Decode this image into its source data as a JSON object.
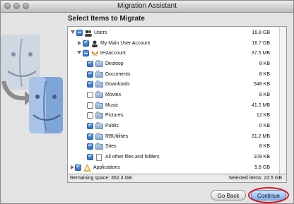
{
  "window": {
    "title": "Migration Assistant"
  },
  "heading": "Select Items to Migrate",
  "items": [
    {
      "label": "Users",
      "size": "16.8 GB",
      "state": "mixed",
      "icon": "users-icon"
    },
    {
      "label": "My Main User Account",
      "size": "16.7 GB",
      "state": "checked",
      "icon": "user-account-icon"
    },
    {
      "label": "testaccount",
      "size": "37.5 MB",
      "state": "mixed",
      "icon": "user-butterfly-icon"
    },
    {
      "label": "Desktop",
      "size": "8 KB",
      "state": "checked",
      "icon": "folder-icon"
    },
    {
      "label": "Documents",
      "size": "8 KB",
      "state": "checked",
      "icon": "folder-icon"
    },
    {
      "label": "Downloads",
      "size": "548 KB",
      "state": "checked",
      "icon": "folder-icon"
    },
    {
      "label": "Movies",
      "size": "8 KB",
      "state": "unchecked",
      "icon": "folder-icon"
    },
    {
      "label": "Music",
      "size": "41.2 MB",
      "state": "unchecked",
      "icon": "folder-icon"
    },
    {
      "label": "Pictures",
      "size": "12 KB",
      "state": "unchecked",
      "icon": "folder-icon"
    },
    {
      "label": "Public",
      "size": "0 KB",
      "state": "checked",
      "icon": "folder-icon"
    },
    {
      "label": "RBUtilities",
      "size": "31.2 MB",
      "state": "checked",
      "icon": "folder-icon"
    },
    {
      "label": "Sites",
      "size": "8 KB",
      "state": "checked",
      "icon": "folder-icon"
    },
    {
      "label": "All other files and folders",
      "size": "109 KB",
      "state": "checked",
      "icon": "document-icon"
    },
    {
      "label": "Applications",
      "size": "5.8 GB",
      "state": "checked",
      "icon": "applications-icon"
    }
  ],
  "status": {
    "remaining": "Remaining space: 352.3 GB",
    "selected": "Selected items: 22.5 GB"
  },
  "buttons": {
    "back": "Go Back",
    "continue": "Continue"
  }
}
